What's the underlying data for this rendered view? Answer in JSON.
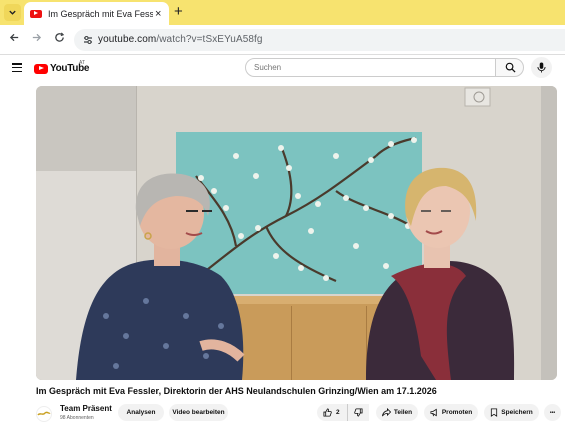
{
  "browser": {
    "tab_title": "Im Gespräch mit Eva Fessler, Di",
    "tab_close": "×",
    "new_tab": "+",
    "url_host": "youtube.com",
    "url_path": "/watch?v=tSxEYuA58fg"
  },
  "youtube": {
    "logo_text": "YouTube",
    "region": "AT",
    "search_placeholder": "Suchen"
  },
  "video": {
    "title": "Im Gespräch mit Eva Fessler, Direktorin der AHS Neulandschulen Grinzing/Wien am 17.1.2026"
  },
  "channel": {
    "name": "Team Präsent",
    "subscribers": "98 Abonnenten"
  },
  "actions": {
    "analytics": "Analysen",
    "edit_video": "Video bearbeiten",
    "like_count": "2",
    "share": "Teilen",
    "promote": "Promoten",
    "save": "Speichern",
    "more": "•••"
  },
  "icons": [
    "tab-search-icon",
    "youtube-favicon",
    "back-icon",
    "forward-icon",
    "reload-icon",
    "site-info-icon",
    "menu-icon",
    "search-icon",
    "mic-icon",
    "like-icon",
    "dislike-icon",
    "share-icon",
    "promote-icon",
    "save-icon",
    "more-icon"
  ],
  "colors": {
    "tabstrip": "#f7e36f",
    "youtube_red": "#ff0000"
  }
}
